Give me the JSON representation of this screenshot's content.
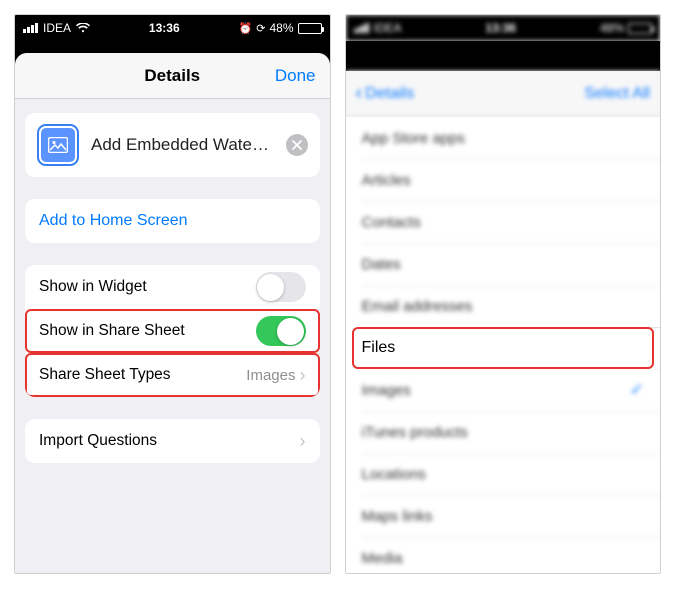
{
  "statusbar": {
    "carrier": "IDEA",
    "time": "13:36",
    "battery_pct": "48%"
  },
  "nav": {
    "title": "Details",
    "done": "Done"
  },
  "shortcut": {
    "name": "Add Embedded Wate…"
  },
  "home": {
    "label": "Add to Home Screen"
  },
  "options": {
    "widget_label": "Show in Widget",
    "sharesheet_label": "Show in Share Sheet",
    "types_label": "Share Sheet Types",
    "types_value": "Images"
  },
  "import": {
    "label": "Import Questions"
  },
  "right": {
    "nav_back": "Details",
    "nav_action": "Select All",
    "items": {
      "i0": "App Store apps",
      "i1": "Articles",
      "i2": "Contacts",
      "i3": "Dates",
      "i4": "Email addresses",
      "i5": "Files",
      "i6": "Images",
      "i7": "iTunes products",
      "i8": "Locations",
      "i9": "Maps links",
      "i10": "Media"
    }
  }
}
